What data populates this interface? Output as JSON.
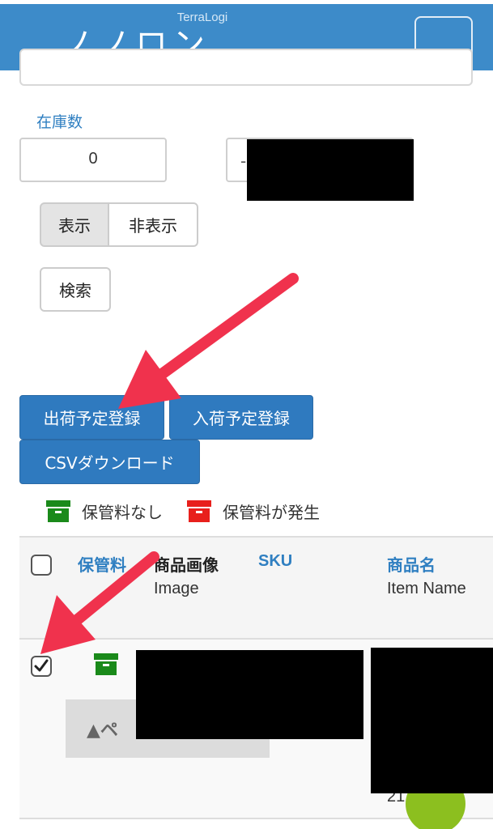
{
  "header": {
    "brand": "TerraLogi",
    "partial_title": "ノノロン",
    "menu_icon": "hamburger-icon"
  },
  "filters": {
    "stock_label": "在庫数",
    "stock_value": "0",
    "stock_operator_partial": "-",
    "display_toggle": {
      "on_label": "表示",
      "off_label": "非表示",
      "selected": "表示"
    },
    "search_label": "検索"
  },
  "actions": {
    "ship_label": "出荷予定登録",
    "receive_label": "入荷予定登録",
    "csv_label": "CSVダウンロード"
  },
  "legend": {
    "no_fee_label": "保管料なし",
    "fee_label": "保管料が発生",
    "no_fee_color": "#1a8a1a",
    "fee_color": "#e8201c",
    "icon": "storage-box-icon"
  },
  "table": {
    "headers": {
      "fee": "保管料",
      "image": "商品画像",
      "image_en": "Image",
      "sku": "SKU",
      "name": "商品名",
      "name_en": "Item Name"
    },
    "rows": [
      {
        "checked": true,
        "fee_status": "no_fee",
        "pager_label": "▲ペ",
        "partial_number": "21"
      }
    ]
  },
  "annotations": {
    "arrow_color": "#f0324d"
  },
  "colors": {
    "header_bg": "#3d8bc9",
    "primary_button": "#2f7abf",
    "link": "#2f7fc1"
  }
}
